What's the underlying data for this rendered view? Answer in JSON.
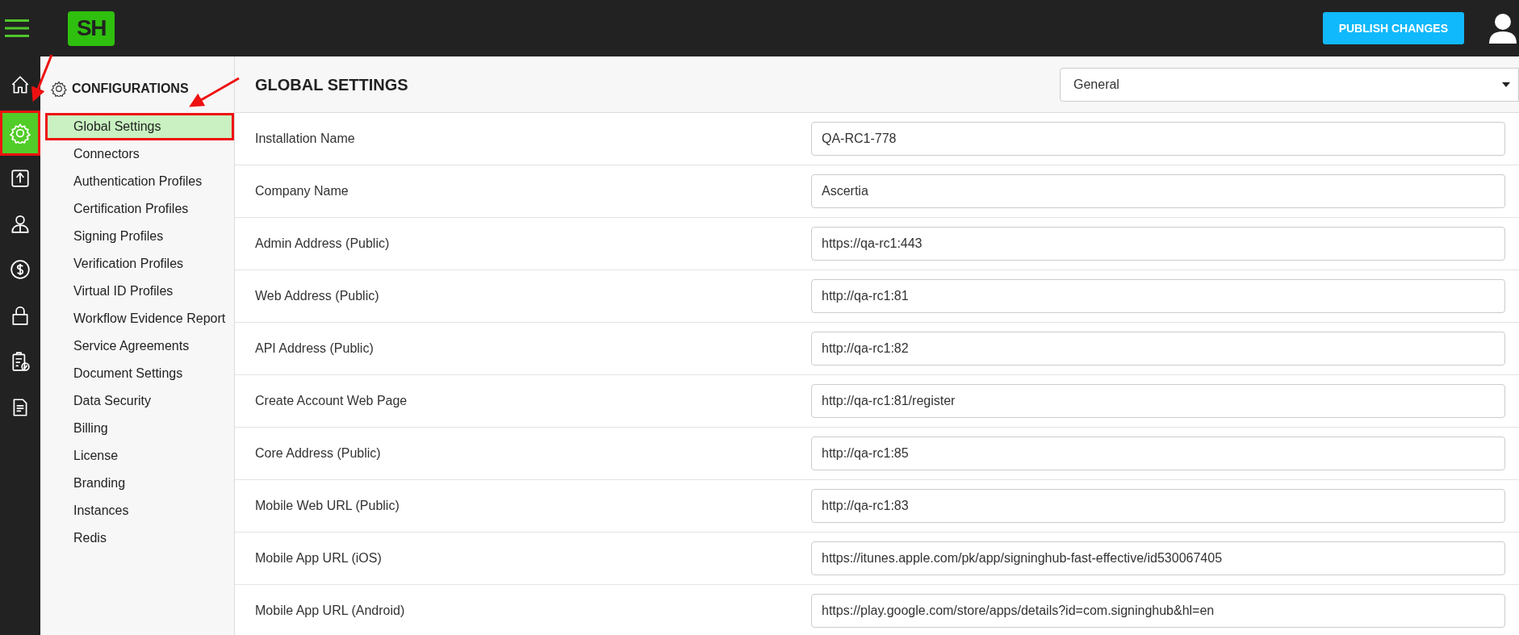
{
  "header": {
    "logo": "SH",
    "publish_button": "PUBLISH CHANGES"
  },
  "rail": [
    {
      "kind": "home",
      "selected": false
    },
    {
      "kind": "gear",
      "selected": true
    },
    {
      "kind": "upload",
      "selected": false
    },
    {
      "kind": "person",
      "selected": false
    },
    {
      "kind": "dollar",
      "selected": false
    },
    {
      "kind": "lock",
      "selected": false
    },
    {
      "kind": "clipboard",
      "selected": false
    },
    {
      "kind": "document",
      "selected": false
    }
  ],
  "sidebar": {
    "title": "CONFIGURATIONS",
    "items": [
      {
        "label": "Global Settings",
        "selected": true
      },
      {
        "label": "Connectors",
        "selected": false
      },
      {
        "label": "Authentication Profiles",
        "selected": false
      },
      {
        "label": "Certification Profiles",
        "selected": false
      },
      {
        "label": "Signing Profiles",
        "selected": false
      },
      {
        "label": "Verification Profiles",
        "selected": false
      },
      {
        "label": "Virtual ID Profiles",
        "selected": false
      },
      {
        "label": "Workflow Evidence Report",
        "selected": false
      },
      {
        "label": "Service Agreements",
        "selected": false
      },
      {
        "label": "Document Settings",
        "selected": false
      },
      {
        "label": "Data Security",
        "selected": false
      },
      {
        "label": "Billing",
        "selected": false
      },
      {
        "label": "License",
        "selected": false
      },
      {
        "label": "Branding",
        "selected": false
      },
      {
        "label": "Instances",
        "selected": false
      },
      {
        "label": "Redis",
        "selected": false
      }
    ]
  },
  "main": {
    "title": "GLOBAL SETTINGS",
    "category_select": "General",
    "fields": [
      {
        "label": "Installation Name",
        "value": "QA-RC1-778"
      },
      {
        "label": "Company Name",
        "value": "Ascertia"
      },
      {
        "label": "Admin Address (Public)",
        "value": "https://qa-rc1:443"
      },
      {
        "label": "Web Address (Public)",
        "value": "http://qa-rc1:81"
      },
      {
        "label": "API Address (Public)",
        "value": "http://qa-rc1:82"
      },
      {
        "label": "Create Account Web Page",
        "value": "http://qa-rc1:81/register"
      },
      {
        "label": "Core Address (Public)",
        "value": "http://qa-rc1:85"
      },
      {
        "label": "Mobile Web URL (Public)",
        "value": "http://qa-rc1:83"
      },
      {
        "label": "Mobile App URL (iOS)",
        "value": "https://itunes.apple.com/pk/app/signinghub-fast-effective/id530067405"
      },
      {
        "label": "Mobile App URL (Android)",
        "value": "https://play.google.com/store/apps/details?id=com.signinghub&hl=en"
      }
    ]
  }
}
